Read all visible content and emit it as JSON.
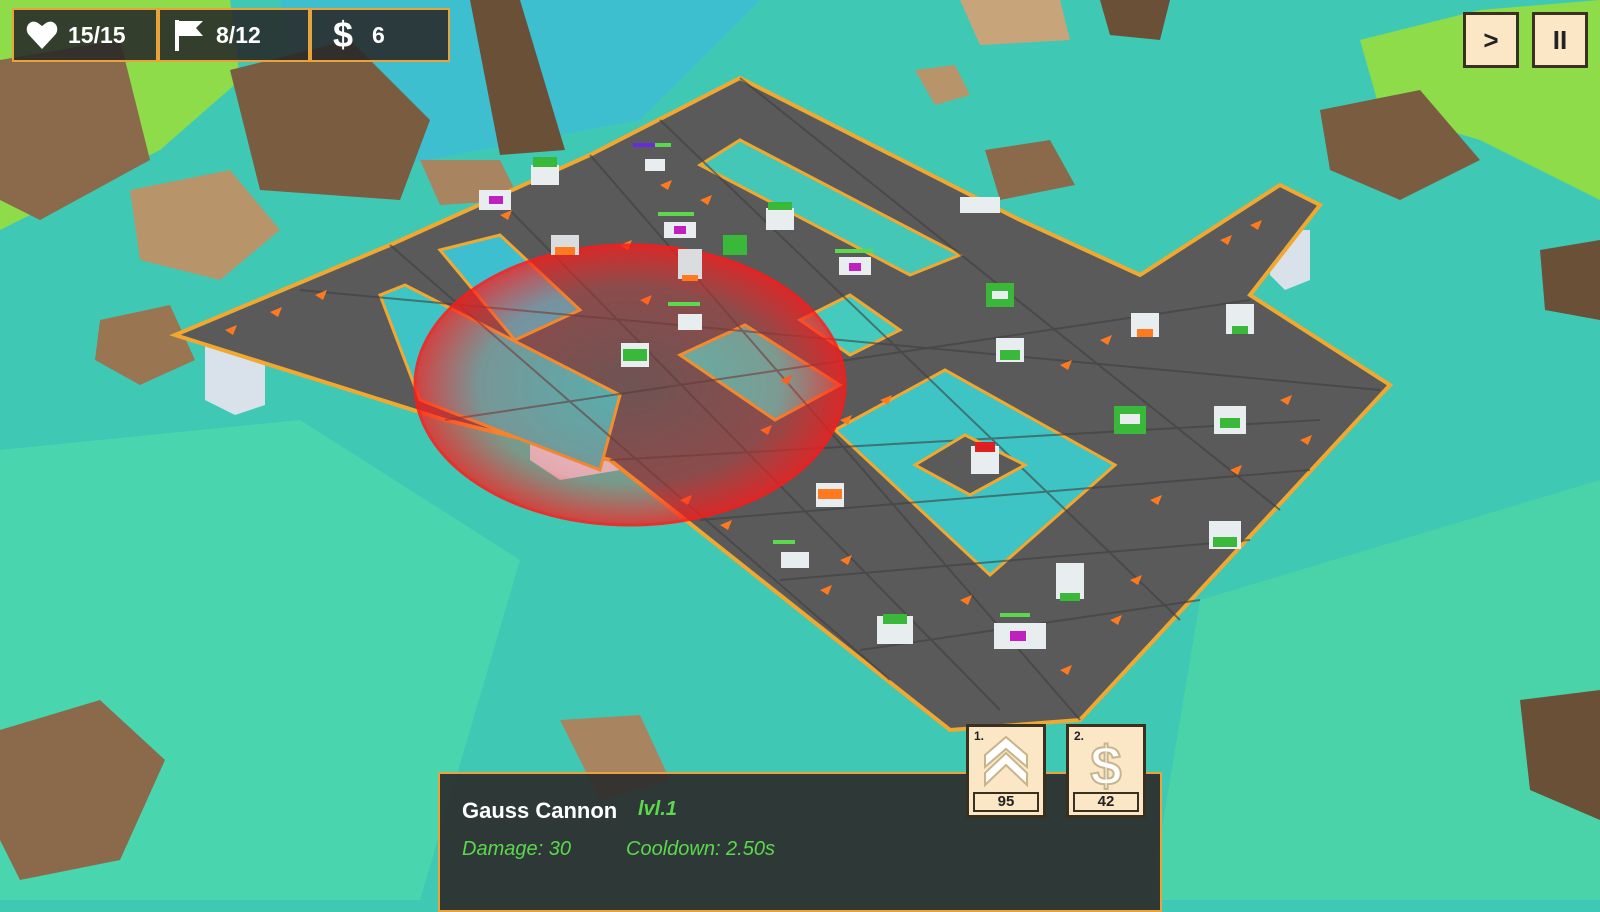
{
  "hud": {
    "lives": "15/15",
    "wave": "8/12",
    "money": "6"
  },
  "controls": {
    "fast_forward_label": ">",
    "pause_label": "II"
  },
  "selected_tower": {
    "name": "Gauss Cannon",
    "level": "lvl.1",
    "damage": "Damage: 30",
    "cooldown": "Cooldown: 2.50s"
  },
  "actions": [
    {
      "hotkey": "1.",
      "icon": "upgrade-chevrons-icon",
      "cost": "95"
    },
    {
      "hotkey": "2.",
      "icon": "sell-dollar-icon",
      "cost": "42"
    }
  ],
  "colors": {
    "accent": "#e8a33a",
    "panel": "#2d2d2d",
    "stat_text": "#5bd84e",
    "button_bg": "#fbe7c6",
    "water": "#3fc9b4",
    "road": "#555555",
    "range_ring": "#ff2a2a"
  }
}
